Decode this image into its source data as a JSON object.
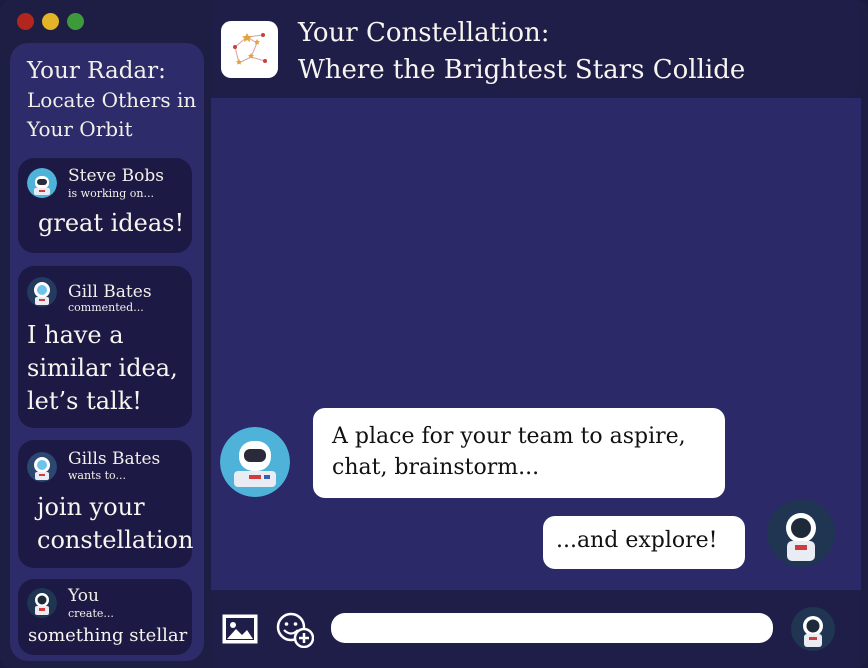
{
  "window": {
    "controls": [
      "close-dot",
      "minimize-dot",
      "maximize-dot"
    ]
  },
  "header": {
    "logo_icon": "constellation-logo-icon",
    "title_line1": "Your Constellation:",
    "title_line2": "Where the Brightest Stars Collide"
  },
  "sidebar": {
    "title_line1": "Your Radar:",
    "title_line2": "Locate Others in",
    "title_line3": "Your Orbit",
    "cards": [
      {
        "name": "Steve Bobs",
        "action": "is working on...",
        "message": [
          "great ideas!"
        ]
      },
      {
        "name": "Gill Bates",
        "action": "commented...",
        "message": [
          "I have a",
          "similar idea,",
          "let’s talk!"
        ]
      },
      {
        "name": "Gills Bates",
        "action": "wants to...",
        "message": [
          "join your",
          "constellation"
        ]
      },
      {
        "name": "You",
        "action": "create...",
        "message": [
          "something stellar"
        ]
      }
    ]
  },
  "chat": {
    "messages": [
      {
        "from": "other",
        "lines": [
          "A place for your team to aspire,",
          "chat, brainstorm..."
        ]
      },
      {
        "from": "self",
        "lines": [
          "...and explore!"
        ]
      }
    ]
  },
  "composer": {
    "image_icon": "image-icon",
    "emoji_icon": "add-emoji-icon",
    "input_value": "",
    "input_placeholder": ""
  },
  "colors": {
    "window_bg": "#1e1d44",
    "sidebar_bg": "#2e2b6a",
    "card_bg": "#1c1a45",
    "chat_bg": "#2b2968",
    "header_bg": "#1f1e48",
    "bubble_bg": "#ffffff",
    "close": "#b3261e",
    "minimize": "#e3b427",
    "maximize": "#3c9a3a"
  }
}
